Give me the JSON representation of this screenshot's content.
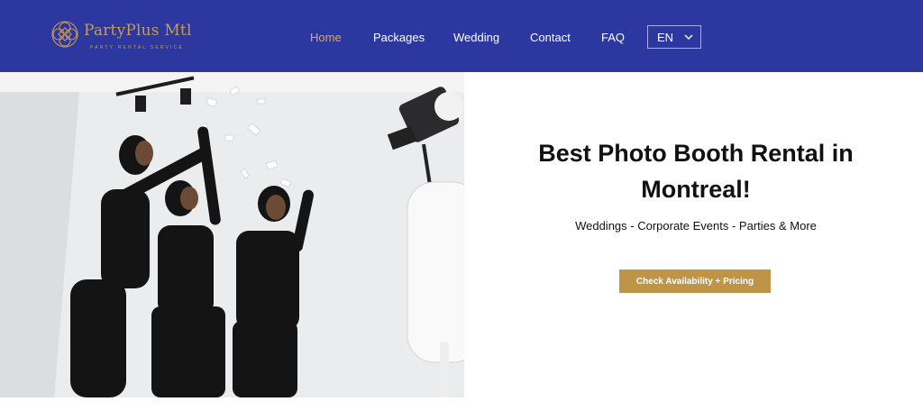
{
  "header": {
    "background": "#2c37a0",
    "logo": {
      "name": "PartyPlus Mtl",
      "tagline": "PARTY RENTAL SERVICE",
      "color": "#c79c52",
      "icon": "ornamental-knot-icon"
    },
    "nav": {
      "items": [
        {
          "label": "Home",
          "active": true
        },
        {
          "label": "Packages",
          "active": false
        },
        {
          "label": "Wedding",
          "active": false
        },
        {
          "label": "Contact",
          "active": false
        },
        {
          "label": "FAQ",
          "active": false
        }
      ],
      "active_color": "#e3a55a"
    },
    "language": {
      "selected": "EN",
      "icon": "chevron-down-icon"
    }
  },
  "hero": {
    "image": "photo of four women throwing confetti next to a white photo booth under studio lights",
    "title": "Best Photo Booth Rental in Montreal!",
    "subtitle": "Weddings - Corporate Events - Parties & More",
    "cta_label": "Check Availability + Pricing",
    "cta_color": "#be9548"
  }
}
